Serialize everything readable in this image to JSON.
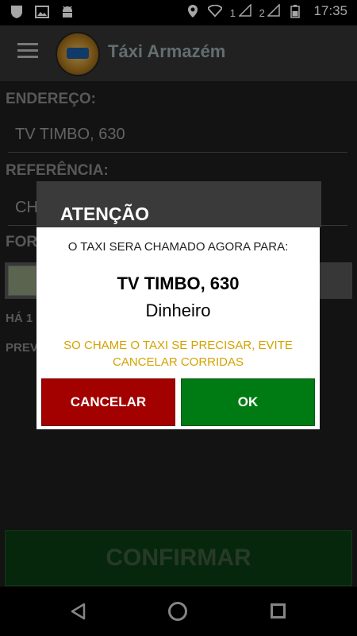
{
  "status_bar": {
    "time": "17:35",
    "sim1": "1",
    "sim2": "2"
  },
  "app_bar": {
    "title": "Táxi Armazém"
  },
  "form": {
    "address_label": "ENDEREÇO:",
    "address_value": "TV TIMBO, 630",
    "reference_label": "REFERÊNCIA:",
    "reference_value": "CH",
    "payment_label": "FOR",
    "time_label": "HÁ 1",
    "forecast_label": "PREV",
    "confirm_label": "CONFIRMAR"
  },
  "dialog": {
    "title": "ATENÇÃO",
    "message": "O TAXI SERA CHAMADO AGORA PARA:",
    "address": "TV TIMBO, 630",
    "payment": "Dinheiro",
    "warning": "SO CHAME O TAXI SE PRECISAR, EVITE CANCELAR CORRIDAS",
    "cancel_label": "CANCELAR",
    "ok_label": "OK"
  },
  "colors": {
    "cancel": "#a30000",
    "ok": "#007a12",
    "warning": "#d4a200"
  }
}
